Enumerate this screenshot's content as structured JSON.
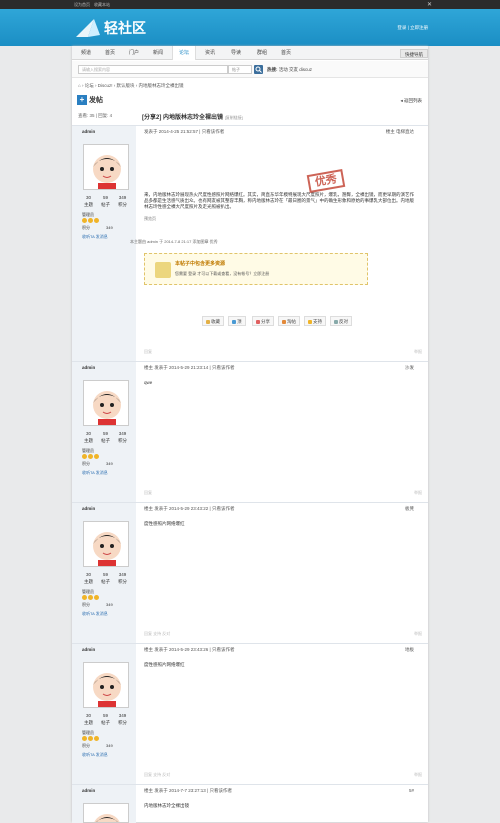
{
  "topbar": {
    "sethome": "设为首页",
    "favorite": "收藏本站",
    "toggle": "✕"
  },
  "header": {
    "logo_text": "轻社区",
    "links": "登录 | 立即注册"
  },
  "nav": {
    "items": [
      "频道",
      "首页",
      "门户",
      "新闻",
      "论坛",
      "资讯",
      "导读",
      "群组",
      "首页"
    ],
    "active_index": 4,
    "quick": "快捷导航"
  },
  "search": {
    "placeholder": "请输入搜索内容",
    "type": "帖子",
    "hot_label": "热搜:",
    "hot_terms": "活动 交友 discuz"
  },
  "breadcrumb": "⌂ › 论坛 › Discuz! › 默认版块 › 内地版林志玲全裸出镜",
  "post_button": "发帖",
  "back_list": "◂ 返回列表",
  "thread": {
    "stats": "查看: 35 | 回复: 4",
    "title": "[分享2] 内地版林志玲全裸出镜",
    "copy": "[复制链接]"
  },
  "posts": [
    {
      "user": "admin",
      "stats": [
        {
          "v": "30",
          "l": "主题"
        },
        {
          "v": "59",
          "l": "帖子"
        },
        {
          "v": "349",
          "l": "积分"
        }
      ],
      "group": "管理员",
      "credit_label": "积分",
      "credit_value": "349",
      "actions": "收听TA   发消息",
      "meta": "发表于 2014-4-25 21:52:57  |  只看该作者",
      "floor": "楼主  电梯直达",
      "body": "来，内地版林志玲展现热火尺度性感照片网络爆红。其实，简直东华年模特展现大尺度照片，爆乳，翘臀，全裸出镜，而更早期的演艺作品多都是生活感气质出众。也有网友被其整容丰胸，称内地版林志玲在「最日圈的景气」中的确生形象和原始的事爆乳大部位出。内地版林志玲性感全裸大尺度照片及走光照被扒出。",
      "extra": "预览页",
      "stamp": "优秀",
      "last_edit": "本主题由 admin 于 2014-7-8 21:17 添加图章 优秀",
      "notice_title": "本帖子中包含更多资源",
      "notice_sub": "您需要 登录 才可以下载或查看，没有帐号？立即注册",
      "buttons": [
        "收藏",
        "顶",
        "分享",
        "淘帖",
        "支持",
        "反对"
      ],
      "foot_left": "回复",
      "foot_right": "举报"
    },
    {
      "user": "admin",
      "stats": [
        {
          "v": "30",
          "l": "主题"
        },
        {
          "v": "59",
          "l": "帖子"
        },
        {
          "v": "349",
          "l": "积分"
        }
      ],
      "group": "管理员",
      "credit_label": "积分",
      "credit_value": "349",
      "actions": "收听TA   发消息",
      "meta": "楼主  发表于 2014-5-29 21:23:14  |  只看该作者",
      "floor": "沙发",
      "body": "qwe",
      "foot_left": "回复",
      "foot_right": "举报"
    },
    {
      "user": "admin",
      "stats": [
        {
          "v": "30",
          "l": "主题"
        },
        {
          "v": "59",
          "l": "帖子"
        },
        {
          "v": "349",
          "l": "积分"
        }
      ],
      "group": "管理员",
      "credit_label": "积分",
      "credit_value": "349",
      "actions": "收听TA   发消息",
      "meta": "楼主  发表于 2014-5-29 23:43:22  |  只看该作者",
      "floor": "板凳",
      "body": "度性感照片网络爆红",
      "foot_left": "回复  支持  反对",
      "foot_right": "举报"
    },
    {
      "user": "admin",
      "stats": [
        {
          "v": "30",
          "l": "主题"
        },
        {
          "v": "59",
          "l": "帖子"
        },
        {
          "v": "349",
          "l": "积分"
        }
      ],
      "group": "管理员",
      "credit_label": "积分",
      "credit_value": "349",
      "actions": "收听TA   发消息",
      "meta": "楼主  发表于 2014-5-29 23:43:26  |  只看该作者",
      "floor": "地板",
      "body": "度性感照片网络爆红",
      "foot_left": "回复  支持  反对",
      "foot_right": "举报"
    },
    {
      "user": "admin",
      "stats": [
        {
          "v": "30",
          "l": "主题"
        },
        {
          "v": "59",
          "l": "帖子"
        },
        {
          "v": "349",
          "l": "积分"
        }
      ],
      "group": "管理员",
      "credit_label": "积分",
      "credit_value": "349",
      "actions": "收听TA   发消息",
      "meta": "楼主  发表于 2014-7-7 23:27:13  |  只看该作者",
      "floor": "5#",
      "body": "内地版林志玲全裸出镜",
      "foot_left": "回复",
      "foot_right": "举报"
    }
  ]
}
